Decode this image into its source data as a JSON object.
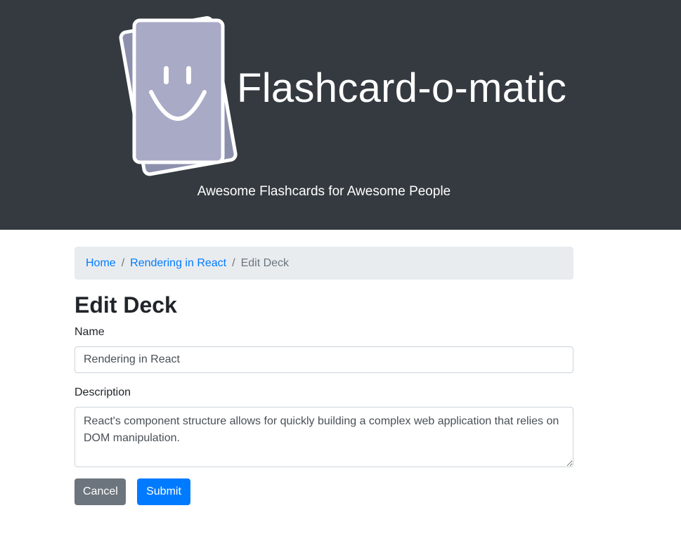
{
  "header": {
    "title": "Flashcard-o-matic",
    "tagline": "Awesome Flashcards for Awesome People",
    "logo_icon": "smiley-flashcards-icon"
  },
  "breadcrumb": {
    "items": [
      {
        "label": "Home",
        "link": true
      },
      {
        "label": "Rendering in React",
        "link": true
      },
      {
        "label": "Edit Deck",
        "link": false
      }
    ],
    "separator": "/"
  },
  "form": {
    "title": "Edit Deck",
    "name_label": "Name",
    "name_value": "Rendering in React",
    "description_label": "Description",
    "description_value": "React's component structure allows for quickly building a complex web application that relies on DOM manipulation.",
    "cancel_label": "Cancel",
    "submit_label": "Submit"
  },
  "colors": {
    "header_bg": "#343a40",
    "link": "#007bff",
    "cancel_bg": "#6c757d",
    "submit_bg": "#007bff",
    "breadcrumb_bg": "#e9ecef",
    "card_fill": "#a8aac6"
  }
}
